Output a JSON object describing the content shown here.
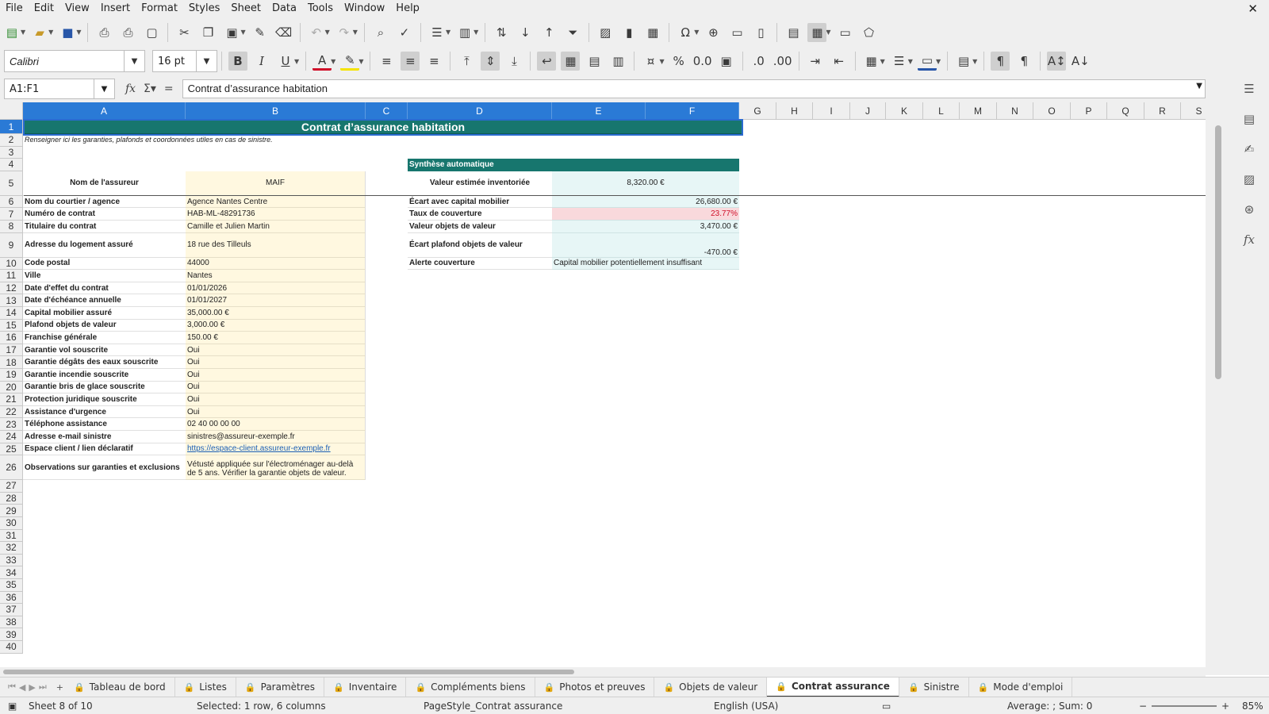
{
  "menu": [
    "File",
    "Edit",
    "View",
    "Insert",
    "Format",
    "Styles",
    "Sheet",
    "Data",
    "Tools",
    "Window",
    "Help"
  ],
  "font": {
    "name": "Calibri",
    "size": "16 pt"
  },
  "formula_bar": {
    "name_box": "A1:F1",
    "content": "Contrat d’assurance habitation"
  },
  "columns": [
    "A",
    "B",
    "C",
    "D",
    "E",
    "F",
    "G",
    "H",
    "I",
    "J",
    "K",
    "L",
    "M",
    "N",
    "O",
    "P",
    "Q",
    "R",
    "S"
  ],
  "rows": [
    "1",
    "2",
    "3",
    "4",
    "5",
    "6",
    "7",
    "8",
    "9",
    "10",
    "11",
    "12",
    "13",
    "14",
    "15",
    "16",
    "17",
    "18",
    "19",
    "20",
    "21",
    "22",
    "23",
    "24",
    "25",
    "26",
    "27",
    "28",
    "29",
    "30",
    "31",
    "32",
    "33",
    "34",
    "35",
    "36",
    "37",
    "38",
    "39",
    "40"
  ],
  "sheet": {
    "title": "Contrat d’assurance habitation",
    "subtitle": "Renseigner ici les garanties, plafonds et coordonnées utiles en cas de sinistre.",
    "fields": [
      {
        "label": "Nom de l'assureur",
        "value": "MAIF"
      },
      {
        "label": "Nom du courtier / agence",
        "value": "Agence Nantes Centre"
      },
      {
        "label": "Numéro de contrat",
        "value": "HAB-ML-48291736"
      },
      {
        "label": "Titulaire du contrat",
        "value": "Camille et Julien Martin"
      },
      {
        "label": "Adresse du logement assuré",
        "value": "18 rue des Tilleuls"
      },
      {
        "label": "Code postal",
        "value": "44000"
      },
      {
        "label": "Ville",
        "value": "Nantes"
      },
      {
        "label": "Date d'effet du contrat",
        "value": "01/01/2026"
      },
      {
        "label": "Date d'échéance annuelle",
        "value": "01/01/2027"
      },
      {
        "label": "Capital mobilier assuré",
        "value": "35,000.00 €"
      },
      {
        "label": "Plafond objets de valeur",
        "value": "3,000.00 €"
      },
      {
        "label": "Franchise générale",
        "value": "150.00 €"
      },
      {
        "label": "Garantie vol souscrite",
        "value": "Oui"
      },
      {
        "label": "Garantie dégâts des eaux souscrite",
        "value": "Oui"
      },
      {
        "label": "Garantie incendie souscrite",
        "value": "Oui"
      },
      {
        "label": "Garantie bris de glace souscrite",
        "value": "Oui"
      },
      {
        "label": "Protection juridique souscrite",
        "value": "Oui"
      },
      {
        "label": "Assistance d'urgence",
        "value": "Oui"
      },
      {
        "label": "Téléphone assistance",
        "value": "02 40 00 00 00"
      },
      {
        "label": "Adresse e-mail sinistre",
        "value": "sinistres@assureur-exemple.fr"
      },
      {
        "label": "Espace client / lien déclaratif",
        "value": "https://espace-client.assureur-exemple.fr"
      },
      {
        "label": "Observations sur garanties et exclusions",
        "value": "Vétusté appliquée sur l'électroménager au-delà de 5 ans. Vérifier la garantie objets de valeur."
      }
    ],
    "summary": {
      "header": "Synthèse automatique",
      "items": [
        {
          "label": "Valeur estimée inventoriée",
          "value": "8,320.00 €"
        },
        {
          "label": "Écart avec capital mobilier",
          "value": "26,680.00 €"
        },
        {
          "label": "Taux de couverture",
          "value": "23.77%"
        },
        {
          "label": "Valeur objets de valeur",
          "value": "3,470.00 €"
        },
        {
          "label": "Écart plafond objets de valeur",
          "value": "-470.00 €"
        },
        {
          "label": "Alerte couverture",
          "value": "Capital mobilier potentiellement insuffisant"
        }
      ]
    }
  },
  "tabs": [
    "Tableau de bord",
    "Listes",
    "Paramètres",
    "Inventaire",
    "Compléments biens",
    "Photos et preuves",
    "Objets de valeur",
    "Contrat assurance",
    "Sinistre",
    "Mode d'emploi"
  ],
  "active_tab": "Contrat assurance",
  "status": {
    "sheet": "Sheet 8 of 10",
    "selection": "Selected: 1 row, 6 columns",
    "page_style": "PageStyle_Contrat assurance",
    "language": "English (USA)",
    "sum": "Average: ; Sum: 0",
    "zoom": "85%"
  },
  "colors": {
    "accent": "#17766e",
    "selection": "#2a7ad6",
    "input_fill": "#fff8e0",
    "summary_fill": "#e7f6f6",
    "alert_fill": "#f9d9dc",
    "alert_text": "#d0102a"
  }
}
